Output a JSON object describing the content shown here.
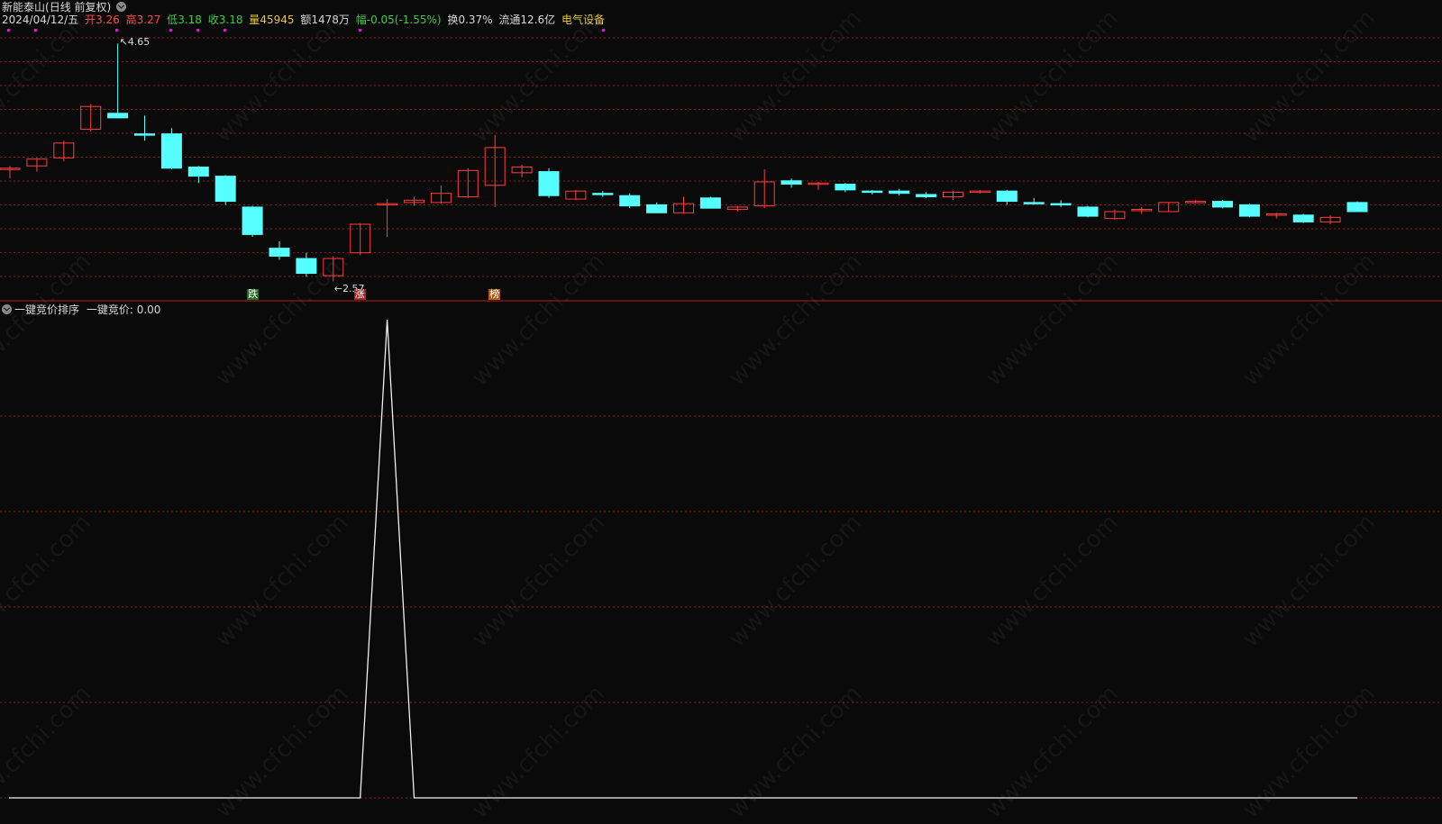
{
  "header": {
    "stock_name": "新能泰山",
    "period_label": "(日线 前复权)",
    "date": "2024/04/12/五",
    "open_label": "开",
    "open_value": "3.26",
    "high_label": "高",
    "high_value": "3.27",
    "low_label": "低",
    "low_value": "3.18",
    "close_label": "收",
    "close_value": "3.18",
    "volume_label": "量",
    "volume_value": "45945",
    "amount_label": "额",
    "amount_value": "1478万",
    "change_label": "幅",
    "change_value": "-0.05(-1.55%)",
    "turnover_label": "换",
    "turnover_value": "0.37%",
    "float_label": "流通",
    "float_value": "12.6亿",
    "sector": "电气设备"
  },
  "indicator": {
    "name": "一键竞价排序",
    "line_label": "一键竞价: 0.00"
  },
  "annotations": {
    "high_price": "4.65",
    "low_price": "2.57",
    "signal_1": "跌",
    "signal_2": "涨",
    "signal_3": "榜"
  },
  "watermark": "www.cfchi.com",
  "colors": {
    "up": "#ff3c3c",
    "down": "#55ffff",
    "grid": "#8a1a1a",
    "signal_green_bg": "#1f6b1f",
    "signal_red_bg": "#b02020",
    "signal_orange_bg": "#b05a1a"
  },
  "chart_data": [
    {
      "type": "candlestick",
      "title": "新能泰山 (日线 前复权)",
      "ylim": [
        2.55,
        4.7
      ],
      "grid": true,
      "candles": [
        {
          "o": 3.55,
          "h": 3.58,
          "l": 3.47,
          "c": 3.56
        },
        {
          "o": 3.58,
          "h": 3.65,
          "l": 3.53,
          "c": 3.64
        },
        {
          "o": 3.65,
          "h": 3.8,
          "l": 3.62,
          "c": 3.78
        },
        {
          "o": 3.9,
          "h": 4.12,
          "l": 3.88,
          "c": 4.1
        },
        {
          "o": 4.04,
          "h": 4.65,
          "l": 4.01,
          "c": 4.0
        },
        {
          "o": 3.86,
          "h": 4.02,
          "l": 3.8,
          "c": 3.85
        },
        {
          "o": 3.86,
          "h": 3.91,
          "l": 3.55,
          "c": 3.56
        },
        {
          "o": 3.57,
          "h": 3.58,
          "l": 3.43,
          "c": 3.49
        },
        {
          "o": 3.49,
          "h": 3.5,
          "l": 3.24,
          "c": 3.27
        },
        {
          "o": 3.22,
          "h": 3.23,
          "l": 2.96,
          "c": 2.98
        },
        {
          "o": 2.86,
          "h": 2.92,
          "l": 2.76,
          "c": 2.79
        },
        {
          "o": 2.77,
          "h": 2.82,
          "l": 2.61,
          "c": 2.64
        },
        {
          "o": 2.62,
          "h": 2.79,
          "l": 2.57,
          "c": 2.77
        },
        {
          "o": 2.82,
          "h": 3.08,
          "l": 2.8,
          "c": 3.07
        },
        {
          "o": 3.25,
          "h": 3.29,
          "l": 2.96,
          "c": 3.25
        },
        {
          "o": 3.26,
          "h": 3.31,
          "l": 3.23,
          "c": 3.28
        },
        {
          "o": 3.26,
          "h": 3.41,
          "l": 3.25,
          "c": 3.34
        },
        {
          "o": 3.31,
          "h": 3.56,
          "l": 3.3,
          "c": 3.54
        },
        {
          "o": 3.41,
          "h": 3.85,
          "l": 3.22,
          "c": 3.74
        },
        {
          "o": 3.52,
          "h": 3.59,
          "l": 3.48,
          "c": 3.57
        },
        {
          "o": 3.53,
          "h": 3.56,
          "l": 3.3,
          "c": 3.32
        },
        {
          "o": 3.29,
          "h": 3.37,
          "l": 3.28,
          "c": 3.36
        },
        {
          "o": 3.34,
          "h": 3.36,
          "l": 3.31,
          "c": 3.33
        },
        {
          "o": 3.32,
          "h": 3.34,
          "l": 3.21,
          "c": 3.23
        },
        {
          "o": 3.24,
          "h": 3.26,
          "l": 3.17,
          "c": 3.17
        },
        {
          "o": 3.17,
          "h": 3.31,
          "l": 3.16,
          "c": 3.25
        },
        {
          "o": 3.3,
          "h": 3.31,
          "l": 3.21,
          "c": 3.21
        },
        {
          "o": 3.2,
          "h": 3.23,
          "l": 3.18,
          "c": 3.22
        },
        {
          "o": 3.23,
          "h": 3.55,
          "l": 3.21,
          "c": 3.44
        },
        {
          "o": 3.45,
          "h": 3.47,
          "l": 3.39,
          "c": 3.42
        },
        {
          "o": 3.42,
          "h": 3.44,
          "l": 3.37,
          "c": 3.43
        },
        {
          "o": 3.42,
          "h": 3.43,
          "l": 3.35,
          "c": 3.37
        },
        {
          "o": 3.36,
          "h": 3.37,
          "l": 3.33,
          "c": 3.35
        },
        {
          "o": 3.36,
          "h": 3.38,
          "l": 3.32,
          "c": 3.34
        },
        {
          "o": 3.33,
          "h": 3.35,
          "l": 3.3,
          "c": 3.31
        },
        {
          "o": 3.31,
          "h": 3.36,
          "l": 3.28,
          "c": 3.35
        },
        {
          "o": 3.35,
          "h": 3.37,
          "l": 3.34,
          "c": 3.36
        },
        {
          "o": 3.36,
          "h": 3.37,
          "l": 3.24,
          "c": 3.27
        },
        {
          "o": 3.26,
          "h": 3.3,
          "l": 3.24,
          "c": 3.25
        },
        {
          "o": 3.25,
          "h": 3.28,
          "l": 3.22,
          "c": 3.24
        },
        {
          "o": 3.22,
          "h": 3.23,
          "l": 3.13,
          "c": 3.14
        },
        {
          "o": 3.12,
          "h": 3.2,
          "l": 3.11,
          "c": 3.18
        },
        {
          "o": 3.19,
          "h": 3.22,
          "l": 3.16,
          "c": 3.2
        },
        {
          "o": 3.18,
          "h": 3.26,
          "l": 3.18,
          "c": 3.26
        },
        {
          "o": 3.27,
          "h": 3.28,
          "l": 3.26,
          "c": 3.27
        },
        {
          "o": 3.27,
          "h": 3.28,
          "l": 3.21,
          "c": 3.22
        },
        {
          "o": 3.24,
          "h": 3.25,
          "l": 3.13,
          "c": 3.14
        },
        {
          "o": 3.15,
          "h": 3.17,
          "l": 3.12,
          "c": 3.16
        },
        {
          "o": 3.15,
          "h": 3.16,
          "l": 3.08,
          "c": 3.09
        },
        {
          "o": 3.09,
          "h": 3.15,
          "l": 3.07,
          "c": 3.13
        },
        {
          "o": 3.26,
          "h": 3.27,
          "l": 3.18,
          "c": 3.18
        }
      ]
    },
    {
      "type": "line",
      "title": "一键竞价排序",
      "series": [
        {
          "name": "一键竞价",
          "values": [
            0,
            0,
            0,
            0,
            0,
            0,
            0,
            0,
            0,
            0,
            0,
            0,
            0,
            0,
            1,
            0,
            0,
            0,
            0,
            0,
            0,
            0,
            0,
            0,
            0,
            0,
            0,
            0,
            0,
            0,
            0,
            0,
            0,
            0,
            0,
            0,
            0,
            0,
            0,
            0,
            0,
            0,
            0,
            0,
            0,
            0,
            0,
            0,
            0,
            0,
            0
          ]
        }
      ],
      "ylim": [
        0,
        1
      ],
      "grid": true
    }
  ]
}
